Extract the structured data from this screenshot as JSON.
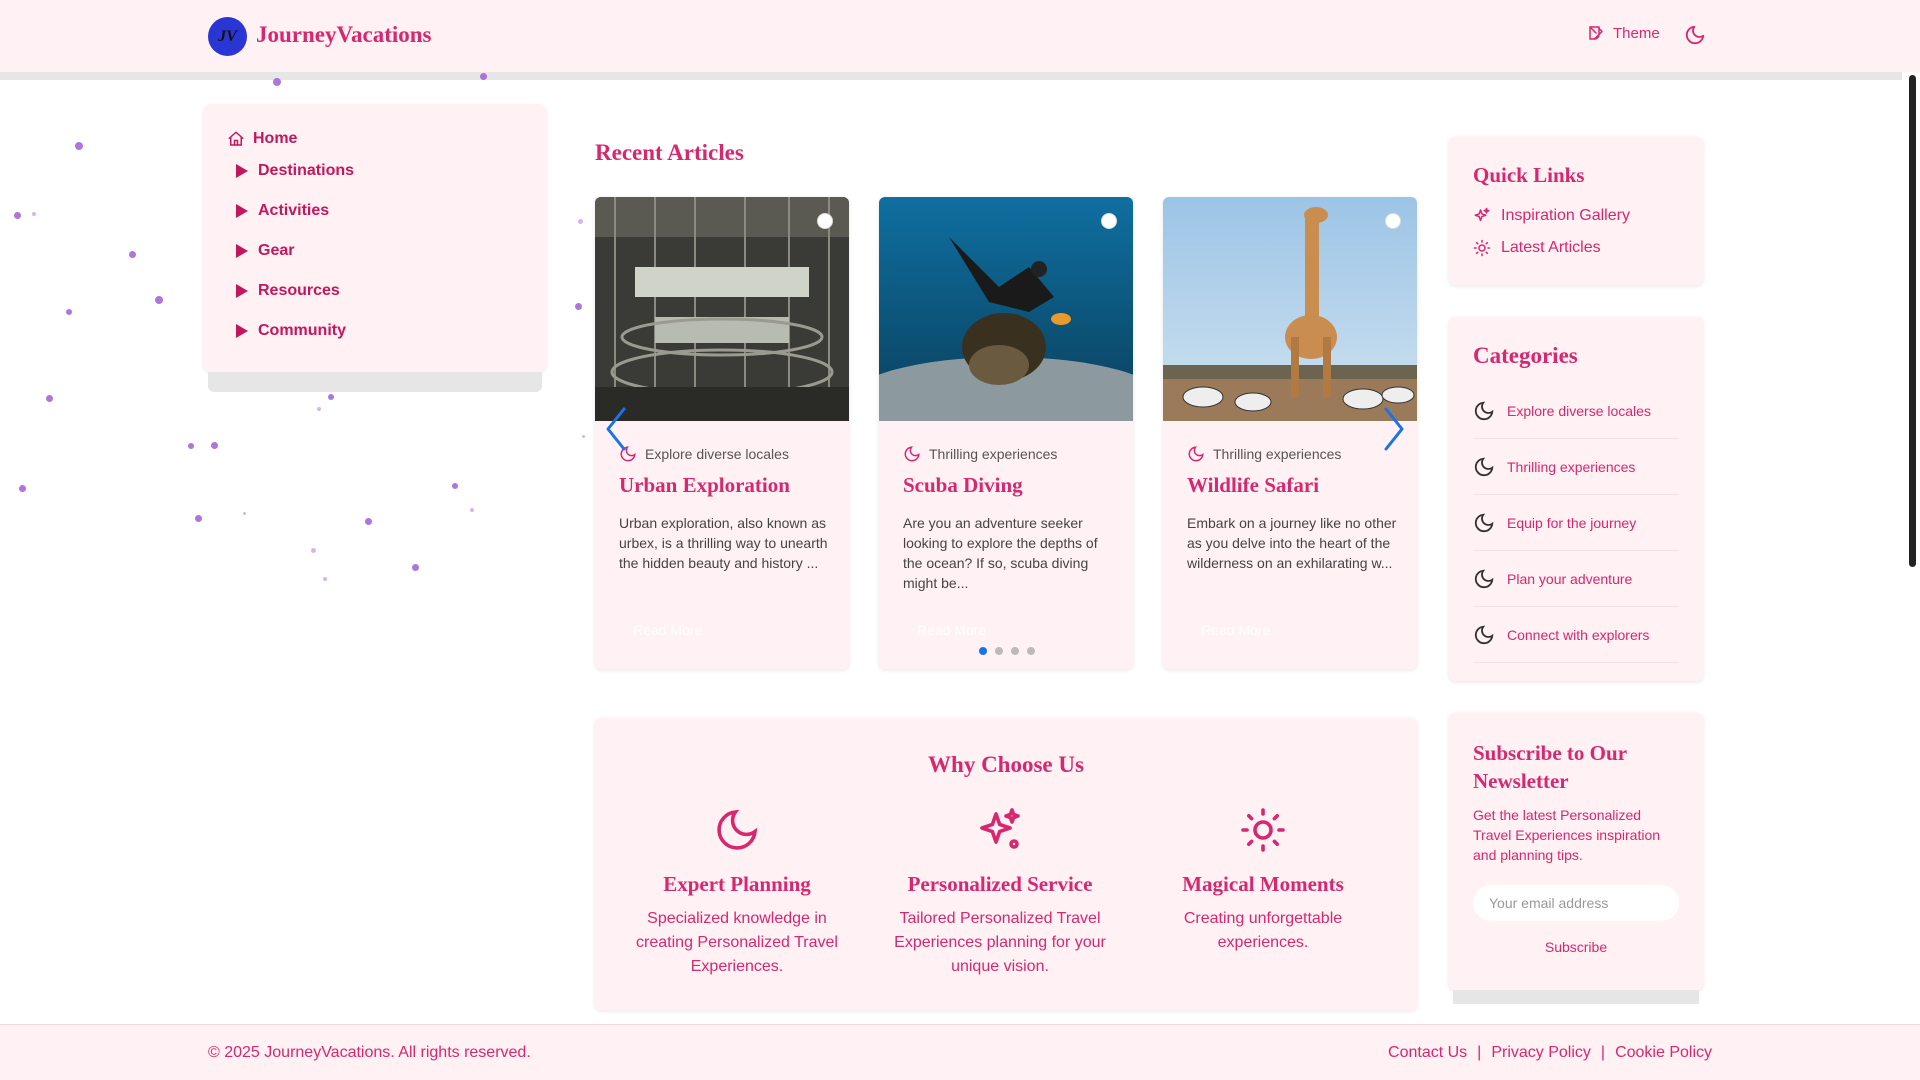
{
  "header": {
    "logo_text": "JV",
    "brand": "JourneyVacations",
    "theme_label": "Theme"
  },
  "nav": {
    "home": "Home",
    "items": [
      "Destinations",
      "Activities",
      "Gear",
      "Resources",
      "Community"
    ]
  },
  "articles": {
    "title": "Recent Articles",
    "cards": [
      {
        "category": "Explore diverse locales",
        "title": "Urban Exploration",
        "text": "Urban exploration, also known as urbex, is a thrilling way to unearth the hidden beauty and history ...",
        "read_more": "Read More"
      },
      {
        "category": "Thrilling experiences",
        "title": "Scuba Diving",
        "text": "Are you an adventure seeker looking to explore the depths of the ocean? If so, scuba diving might be...",
        "read_more": "Read More"
      },
      {
        "category": "Thrilling experiences",
        "title": "Wildlife Safari",
        "text": "Embark on a journey like no other as you delve into the heart of the wilderness on an exhilarating w...",
        "read_more": "Read More"
      }
    ],
    "pager_active": 0,
    "pager_count": 4
  },
  "why": {
    "title": "Why Choose Us",
    "features": [
      {
        "icon": "moon-icon",
        "title": "Expert Planning",
        "text": "Specialized knowledge in creating Personalized Travel Experiences."
      },
      {
        "icon": "sparkles-icon",
        "title": "Personalized Service",
        "text": "Tailored Personalized Travel Experiences planning for your unique vision."
      },
      {
        "icon": "sun-icon",
        "title": "Magical Moments",
        "text": "Creating unforgettable experiences."
      }
    ]
  },
  "quick_links": {
    "title": "Quick Links",
    "items": [
      "Inspiration Gallery",
      "Latest Articles"
    ]
  },
  "categories": {
    "title": "Categories",
    "items": [
      "Explore diverse locales",
      "Thrilling experiences",
      "Equip for the journey",
      "Plan your adventure",
      "Connect with explorers"
    ]
  },
  "newsletter": {
    "title": "Subscribe to Our Newsletter",
    "text": "Get the latest Personalized Travel Experiences inspiration and planning tips.",
    "placeholder": "Your email address",
    "button": "Subscribe"
  },
  "footer": {
    "copyright": "© 2025 JourneyVacations. All rights reserved.",
    "links": [
      "Contact Us",
      "Privacy Policy",
      "Cookie Policy"
    ],
    "separator": "|"
  },
  "colors": {
    "accent": "#d6286e",
    "panel_bg": "#fff1f4",
    "logo_bg": "#2a36d4",
    "carousel_arrow": "#1a73e8",
    "particle": "#a05ed6"
  }
}
